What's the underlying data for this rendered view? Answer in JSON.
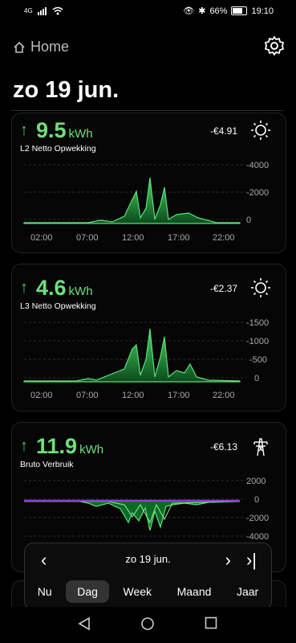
{
  "status": {
    "left_text": "4G",
    "battery": "66%",
    "time": "19:10"
  },
  "header": {
    "title": "Home"
  },
  "date_title": "zo 19 jun.",
  "cards": [
    {
      "value": "9.5",
      "unit": "kWh",
      "label": "L2 Netto Opwekking",
      "cost": "-€4.91",
      "icon": "sun-icon",
      "chart_data": {
        "type": "area",
        "x_ticks": [
          "02:00",
          "07:00",
          "12:00",
          "17:00",
          "22:00"
        ],
        "y_ticks": [
          "-4000",
          "-2000",
          "0"
        ],
        "ylim": [
          0,
          -4000
        ]
      }
    },
    {
      "value": "4.6",
      "unit": "kWh",
      "label": "L3 Netto Opwekking",
      "cost": "-€2.37",
      "icon": "sun-icon",
      "chart_data": {
        "type": "area",
        "x_ticks": [
          "02:00",
          "07:00",
          "12:00",
          "17:00",
          "22:00"
        ],
        "y_ticks": [
          "-1500",
          "-1000",
          "-500",
          "0"
        ],
        "ylim": [
          0,
          -1500
        ]
      }
    },
    {
      "value": "11.9",
      "unit": "kWh",
      "label": "Bruto Verbruik",
      "cost": "-€6.13",
      "icon": "power-tower-icon",
      "chart_data": {
        "type": "area",
        "y_ticks": [
          "2000",
          "0",
          "-2000",
          "-4000"
        ]
      }
    }
  ],
  "datenav": {
    "current": "zo 19 jun.",
    "tabs": [
      "Nu",
      "Dag",
      "Week",
      "Maand",
      "Jaar"
    ],
    "active": "Dag"
  }
}
